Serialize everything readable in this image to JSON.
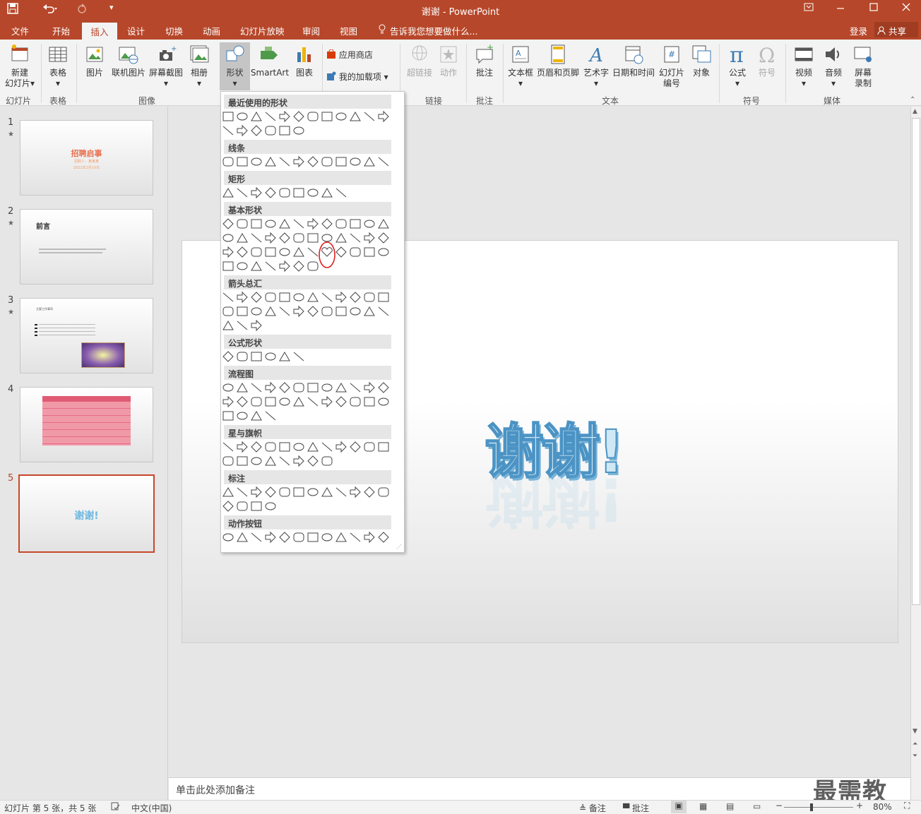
{
  "window": {
    "title": "谢谢 - PowerPoint"
  },
  "quick_access": {
    "save_icon": "save-icon",
    "undo_icon": "undo-icon",
    "redo_icon": "redo-icon",
    "customize_icon": "customize-qat-icon"
  },
  "window_controls": {
    "ribbon_display_icon": "ribbon-display-icon",
    "minimize_icon": "minimize-icon",
    "maximize_icon": "maximize-icon",
    "close_icon": "close-icon"
  },
  "tabs": [
    "文件",
    "开始",
    "插入",
    "设计",
    "切换",
    "动画",
    "幻灯片放映",
    "审阅",
    "视图"
  ],
  "active_tab": "插入",
  "tell_me": "告诉我您想要做什么...",
  "account": {
    "signin": "登录",
    "share": "共享"
  },
  "ribbon": {
    "new_slide": "新建\n幻灯片",
    "table": "表格",
    "picture": "图片",
    "online_picture": "联机图片",
    "screenshot": "屏幕截图",
    "album": "相册",
    "shapes": "形状",
    "smartart": "SmartArt",
    "chart": "图表",
    "store": "应用商店",
    "my_addins": "我的加载项",
    "hyperlink": "超链接",
    "action": "动作",
    "comment": "批注",
    "textbox": "文本框",
    "header_footer": "页眉和页脚",
    "wordart": "艺术字",
    "datetime": "日期和时间",
    "slide_number": "幻灯片\n编号",
    "object": "对象",
    "equation": "公式",
    "symbol": "符号",
    "video": "视频",
    "audio": "音频",
    "screen_recording": "屏幕\n录制",
    "groups": {
      "slides": "幻灯片",
      "tables": "表格",
      "images": "图像",
      "links": "链接",
      "comments": "批注",
      "text": "文本",
      "symbols": "符号",
      "media": "媒体"
    }
  },
  "shapes_gallery": {
    "sections": [
      "最近使用的形状",
      "线条",
      "矩形",
      "基本形状",
      "箭头总汇",
      "公式形状",
      "流程图",
      "星与旗帜",
      "标注",
      "动作按钮"
    ],
    "highlighted_shape": "heart-shape"
  },
  "thumbnails": [
    {
      "number": "1",
      "star": "★",
      "title": "招聘启事",
      "sub1": "招聘人：某某某",
      "sub2": "2021年1月10日"
    },
    {
      "number": "2",
      "star": "★",
      "title": "前言"
    },
    {
      "number": "3",
      "star": "★",
      "title": "主要工作事项"
    },
    {
      "number": "4",
      "star": ""
    },
    {
      "number": "5",
      "star": "",
      "title": "谢谢!"
    }
  ],
  "slide": {
    "title": "谢谢!"
  },
  "notes": {
    "placeholder": "单击此处添加备注"
  },
  "status": {
    "slide_info": "幻灯片 第 5 张，共 5 张",
    "language": "中文(中国)",
    "notes": "备注",
    "comments": "批注",
    "zoom": "80%",
    "zoom_level": 0.4
  },
  "watermark": "最需教育",
  "colors": {
    "accent": "#b7472a",
    "ribbon_bg": "#f3f3f3",
    "slide_text": "#6fb8e0"
  }
}
